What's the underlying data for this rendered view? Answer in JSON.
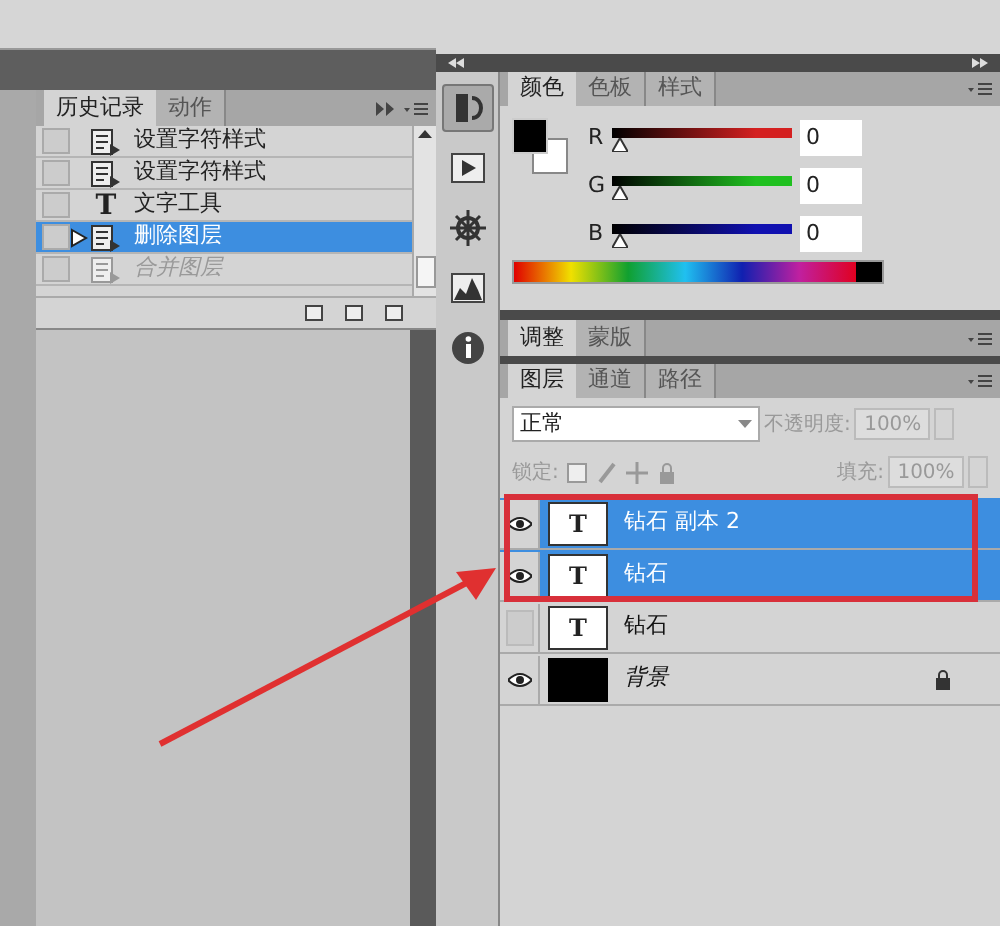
{
  "history_panel": {
    "tabs": [
      {
        "label": "历史记录",
        "selected": true
      },
      {
        "label": "动作",
        "selected": false
      }
    ],
    "items": [
      {
        "kind": "step",
        "label": "设置字符样式",
        "selected": false,
        "disabled": false,
        "current_state": false
      },
      {
        "kind": "step",
        "label": "设置字符样式",
        "selected": false,
        "disabled": false,
        "current_state": false
      },
      {
        "kind": "type",
        "glyph": "T",
        "label": "文字工具",
        "selected": false,
        "disabled": false,
        "current_state": false
      },
      {
        "kind": "step",
        "label": "删除图层",
        "selected": true,
        "disabled": false,
        "current_state": true
      },
      {
        "kind": "step",
        "label": "合并图层",
        "selected": false,
        "disabled": true,
        "current_state": false
      }
    ]
  },
  "dock_icons": [
    {
      "kind": "history",
      "selected": true
    },
    {
      "kind": "actions",
      "selected": false
    },
    {
      "kind": "navigator",
      "selected": false
    },
    {
      "kind": "histogram",
      "selected": false
    },
    {
      "kind": "info",
      "selected": false
    }
  ],
  "color_panel": {
    "tabs": [
      {
        "label": "颜色",
        "selected": true
      },
      {
        "label": "色板",
        "selected": false
      },
      {
        "label": "样式",
        "selected": false
      }
    ],
    "channels": [
      {
        "label": "R",
        "color": "#d42020",
        "level": 0,
        "value": "0"
      },
      {
        "label": "G",
        "color": "#20c020",
        "level": 0,
        "value": "0"
      },
      {
        "label": "B",
        "color": "#1010b0",
        "level": 0,
        "value": "0"
      }
    ]
  },
  "adjustments_panel": {
    "tabs": [
      {
        "label": "调整",
        "selected": true
      },
      {
        "label": "蒙版",
        "selected": false
      }
    ]
  },
  "layers_panel": {
    "tabs": [
      {
        "label": "图层",
        "selected": true
      },
      {
        "label": "通道",
        "selected": false
      },
      {
        "label": "路径",
        "selected": false
      }
    ],
    "blend_mode": "正常",
    "opacity_label": "不透明度:",
    "opacity": "100%",
    "lock_label": "锁定:",
    "fill_label": "填充:",
    "fill": "100%",
    "layers": [
      {
        "kind": "text",
        "glyph": "T",
        "name": "钻石 副本 2",
        "visible": true,
        "selected": true,
        "locked": false
      },
      {
        "kind": "text",
        "glyph": "T",
        "name": "钻石",
        "visible": true,
        "selected": true,
        "locked": false
      },
      {
        "kind": "text",
        "glyph": "T",
        "name": "钻石",
        "visible": false,
        "selected": false,
        "locked": false
      },
      {
        "kind": "fill",
        "name": "背景",
        "visible": true,
        "selected": false,
        "locked": true
      }
    ]
  }
}
